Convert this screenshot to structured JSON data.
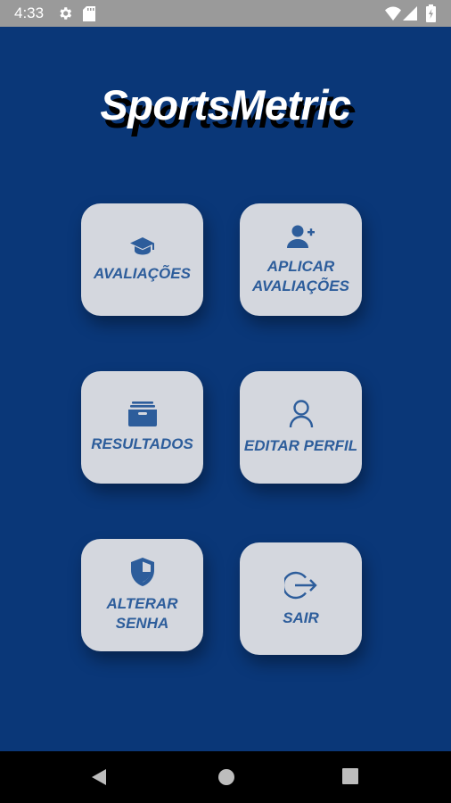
{
  "status_bar": {
    "time": "4:33",
    "icons": [
      "gear-icon",
      "sd-card-icon",
      "wifi-icon",
      "signal-icon",
      "battery-icon"
    ]
  },
  "app": {
    "title": "SportsMetric",
    "background_color": "#0a3778",
    "tile_color": "#d4d7de",
    "accent_color": "#2d5d9b"
  },
  "tiles": [
    {
      "label": "AVALIAÇÕES",
      "icon": "graduation-cap-icon"
    },
    {
      "label": "APLICAR\nAVALIAÇÕES",
      "icon": "add-user-icon"
    },
    {
      "label": "RESULTADOS",
      "icon": "archive-box-icon"
    },
    {
      "label": "EDITAR PERFIL",
      "icon": "user-outline-icon"
    },
    {
      "label": "ALTERAR\nSENHA",
      "icon": "shield-icon"
    },
    {
      "label": "SAIR",
      "icon": "logout-icon"
    }
  ],
  "nav_bar": {
    "buttons": [
      "back-icon",
      "home-icon",
      "recents-icon"
    ]
  }
}
